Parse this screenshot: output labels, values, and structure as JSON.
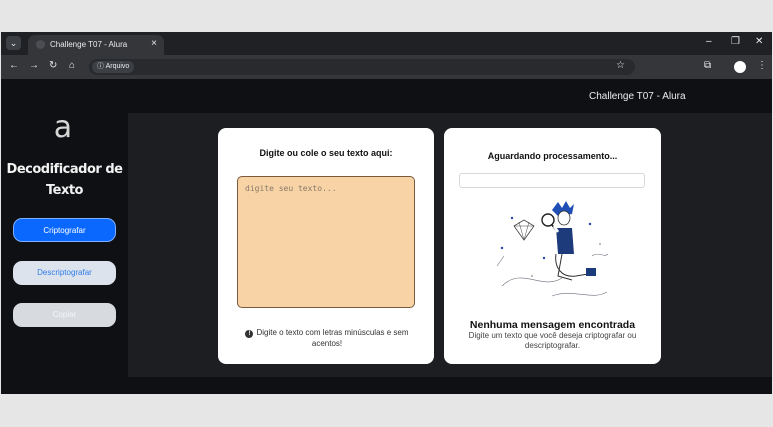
{
  "browser": {
    "tab_title": "Challenge T07 - Alura",
    "tab_close": "×",
    "new_tab": "",
    "address_chip": "Arquivo",
    "window_controls": {
      "minimize": "–",
      "restore": "❐",
      "close": "✕"
    }
  },
  "header": {
    "title": "Challenge T07 - Alura"
  },
  "sidebar": {
    "logo": "a",
    "app_title_line1": "Decodificador de",
    "app_title_line2": "Texto",
    "buttons": {
      "encrypt": "Criptografar",
      "decrypt": "Descriptografar",
      "copy": "Copiar"
    }
  },
  "input_card": {
    "heading": "Digite ou cole o seu texto aqui:",
    "placeholder": "digite seu texto...",
    "hint": "Digite o texto com letras minúsculas e sem acentos!"
  },
  "output_card": {
    "heading": "Aguardando processamento...",
    "empty_title": "Nenhuma mensagem encontrada",
    "empty_subtitle": "Digite um texto que você deseja criptografar ou descriptografar."
  },
  "colors": {
    "primary_button": "#0a68ff",
    "textarea_bg": "#f7d3a6",
    "page_bg": "#0e1013",
    "content_bg": "#1c1e21"
  }
}
